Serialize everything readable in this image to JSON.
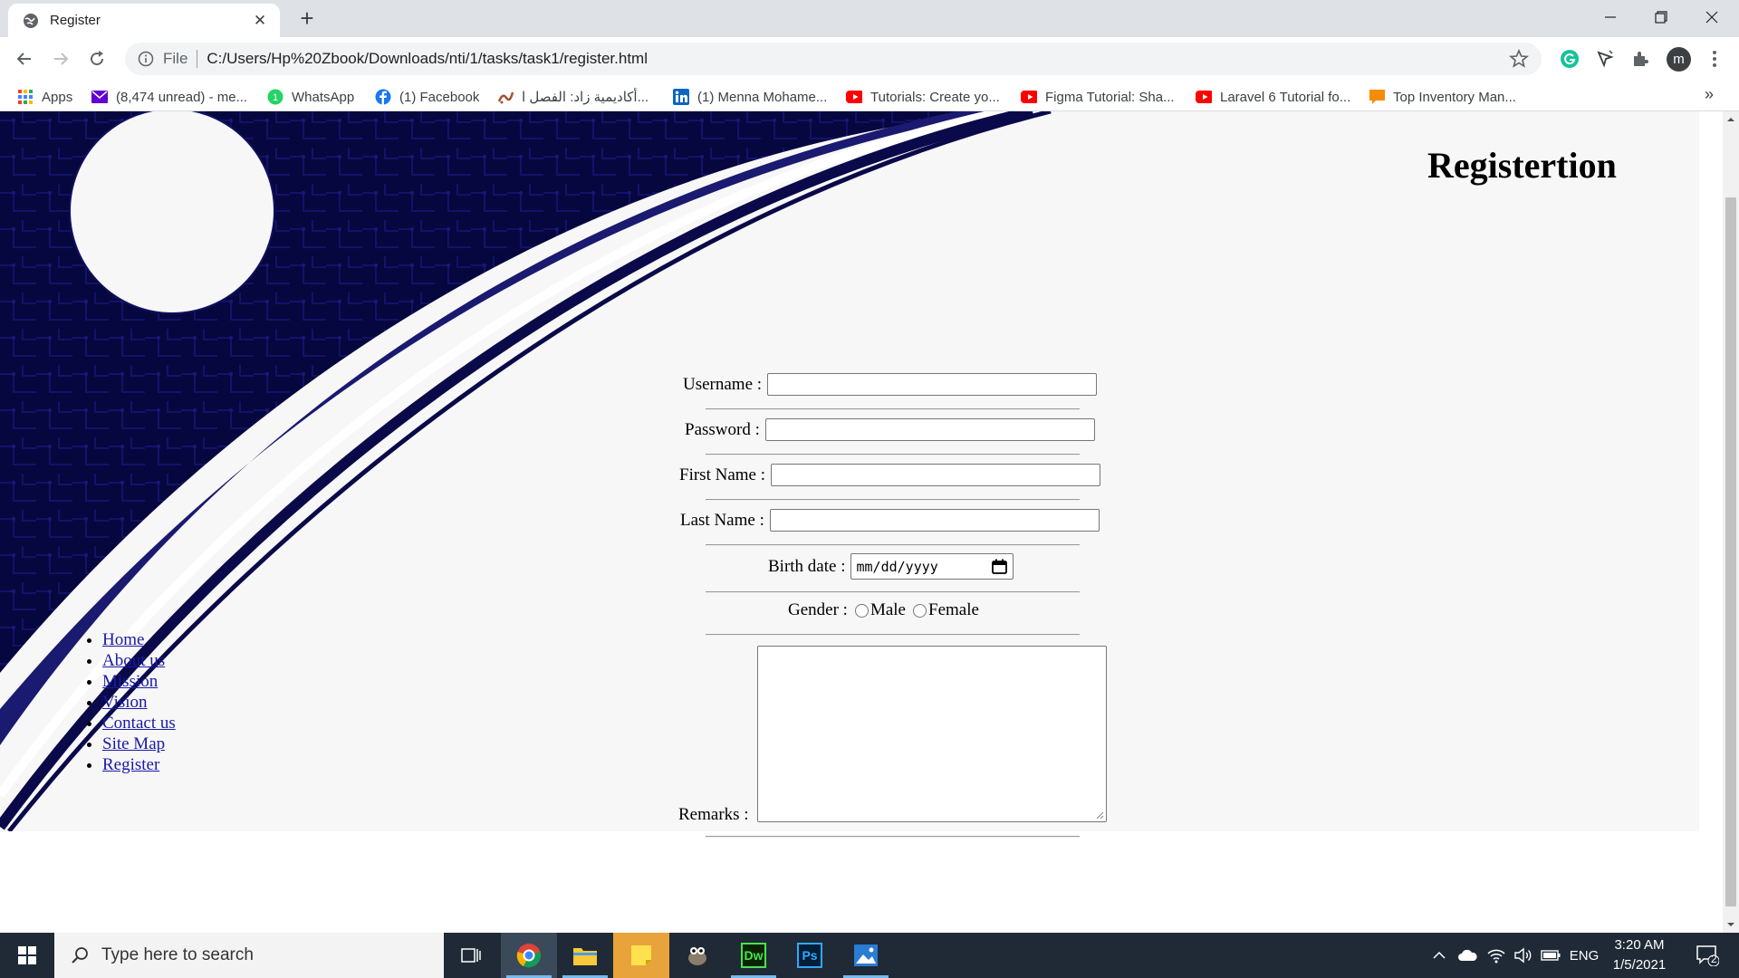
{
  "browser": {
    "tab_title": "Register",
    "address_scheme": "File",
    "address_url": "C:/Users/Hp%20Zbook/Downloads/nti/1/tasks/task1/register.html",
    "profile_initial": "m"
  },
  "bookmarks": [
    {
      "label": "Apps",
      "icon": "apps-grid-icon"
    },
    {
      "label": "(8,474 unread) - me...",
      "icon": "mail-icon"
    },
    {
      "label": "WhatsApp",
      "icon": "whatsapp-icon"
    },
    {
      "label": "(1) Facebook",
      "icon": "facebook-icon"
    },
    {
      "label": "أكاديمية زاد: الفصل ا...",
      "icon": "zad-icon"
    },
    {
      "label": "(1) Menna Mohame...",
      "icon": "linkedin-icon"
    },
    {
      "label": "Tutorials: Create yo...",
      "icon": "youtube-icon"
    },
    {
      "label": "Figma Tutorial: Sha...",
      "icon": "youtube-icon"
    },
    {
      "label": "Laravel 6 Tutorial fo...",
      "icon": "youtube-icon"
    },
    {
      "label": "Top Inventory Man...",
      "icon": "chat-icon"
    }
  ],
  "page": {
    "heading": "Registertion",
    "nav": [
      "Home",
      "About us",
      "Mission",
      "Vision",
      "Contact us",
      "Site Map",
      "Register"
    ],
    "form": {
      "username_label": "Username :",
      "username_value": "",
      "password_label": "Password :",
      "password_value": "",
      "firstname_label": "First Name :",
      "firstname_value": "",
      "lastname_label": "Last Name :",
      "lastname_value": "",
      "birthdate_label": "Birth date :",
      "birthdate_placeholder": "mm/dd/yyyy",
      "gender_label": "Gender :",
      "gender_options": [
        "Male",
        "Female"
      ],
      "remarks_label": "Remarks :",
      "remarks_value": ""
    }
  },
  "taskbar": {
    "search_placeholder": "Type here to search",
    "language": "ENG",
    "time": "3:20 AM",
    "date": "1/5/2021",
    "notification_count": "2",
    "apps": [
      "chrome-icon",
      "file-explorer-icon",
      "sticky-notes-icon",
      "gimp-icon",
      "dreamweaver-icon",
      "photoshop-icon",
      "photos-icon"
    ],
    "dreamweaver_label": "Dw",
    "photoshop_label": "Ps"
  },
  "colors": {
    "page_background": "#f7f7f7",
    "art_navy": "#0a0a4a",
    "taskbar": "#1f2a36"
  }
}
